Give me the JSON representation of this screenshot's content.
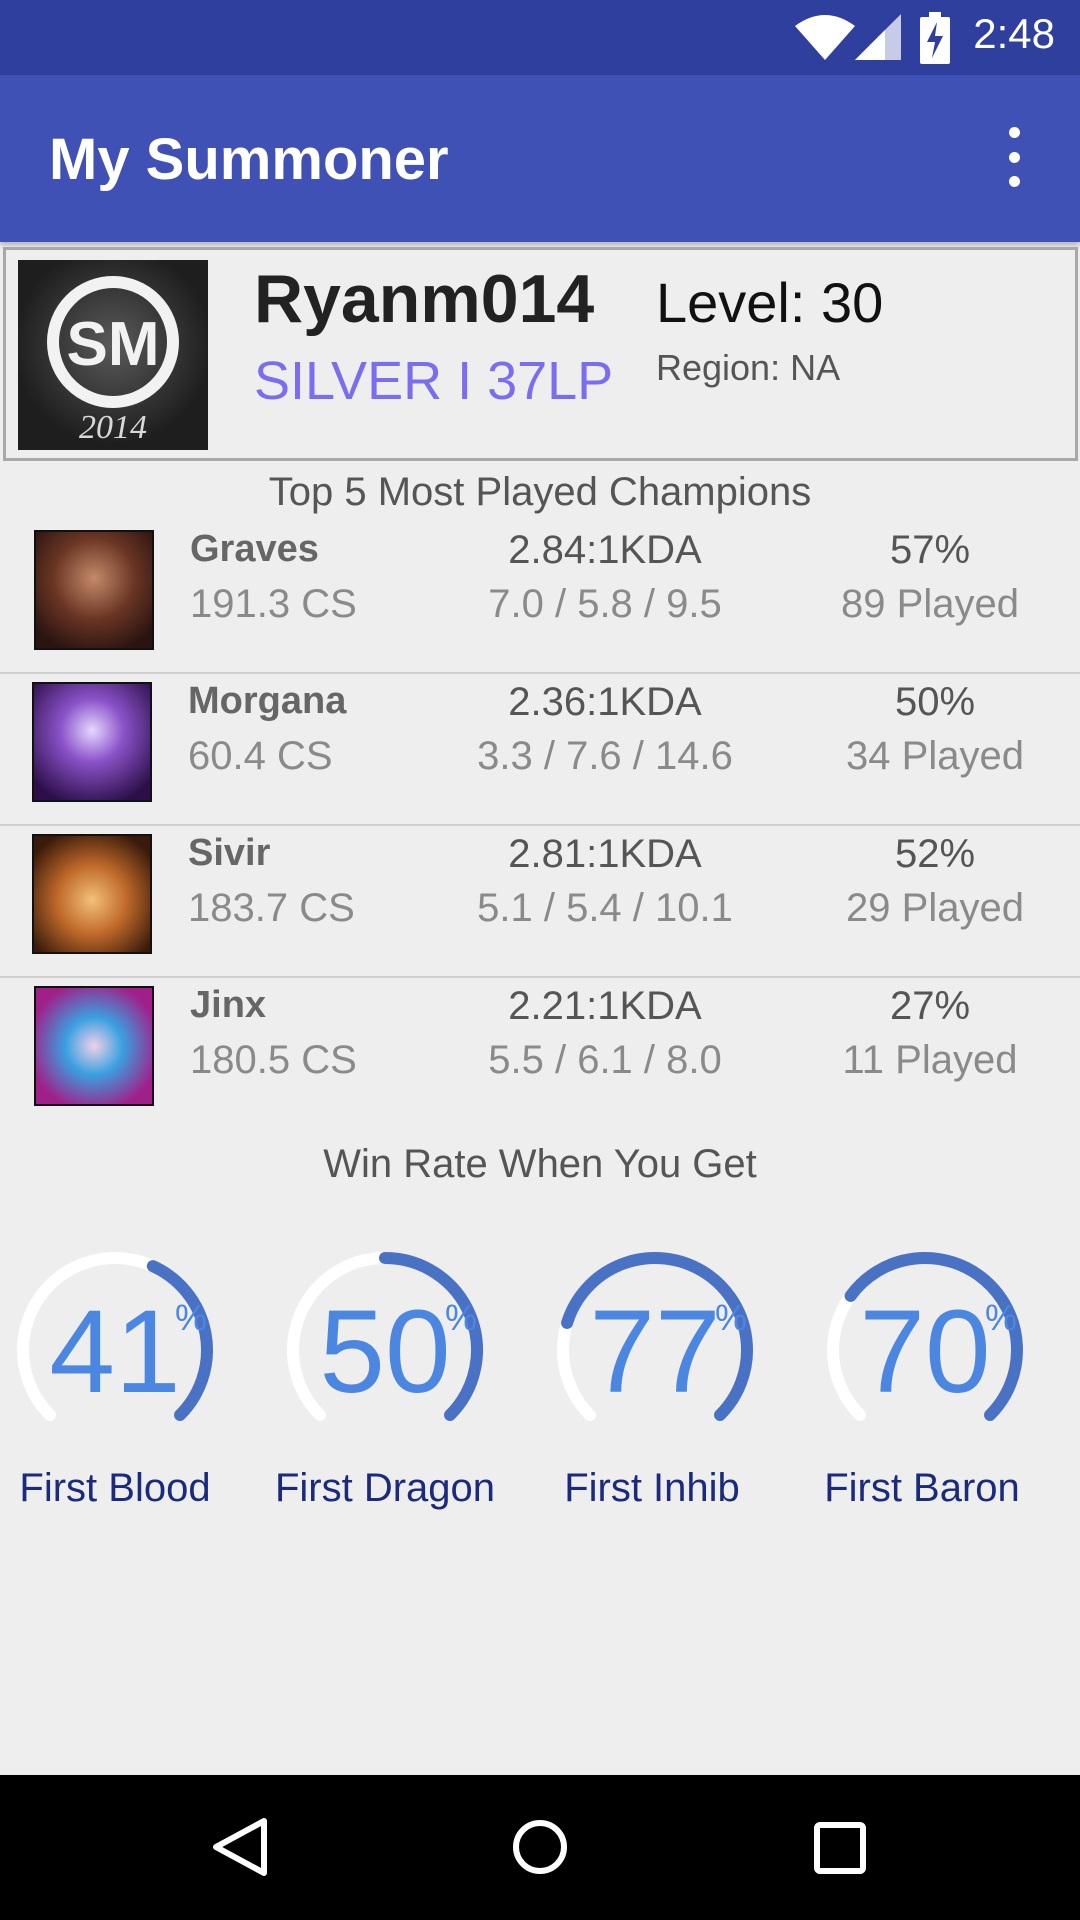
{
  "status_bar": {
    "time": "2:48",
    "icons": [
      "wifi-icon",
      "signal-icon",
      "battery-charging-icon"
    ]
  },
  "app_bar": {
    "title": "My Summoner",
    "overflow_icon": "more-vert-icon"
  },
  "summoner": {
    "icon_text": "2014",
    "icon_logo": "SM",
    "name": "Ryanm014",
    "rank": "SILVER I 37LP",
    "level": "Level: 30",
    "region": "Region: NA"
  },
  "champions_section": {
    "title": "Top 5 Most Played Champions",
    "rows": [
      {
        "name": "Graves",
        "cs": "191.3 CS",
        "kda": "2.84:1KDA",
        "kda_detail": "7.0 / 5.8 / 9.5",
        "winrate": "57%",
        "played": "89 Played"
      },
      {
        "name": "Morgana",
        "cs": "60.4 CS",
        "kda": "2.36:1KDA",
        "kda_detail": "3.3 / 7.6 / 14.6",
        "winrate": "50%",
        "played": "34 Played"
      },
      {
        "name": "Sivir",
        "cs": "183.7 CS",
        "kda": "2.81:1KDA",
        "kda_detail": "5.1 / 5.4 / 10.1",
        "winrate": "52%",
        "played": "29 Played"
      },
      {
        "name": "Jinx",
        "cs": "180.5 CS",
        "kda": "2.21:1KDA",
        "kda_detail": "5.5 / 6.1 / 8.0",
        "winrate": "27%",
        "played": "11 Played"
      }
    ]
  },
  "winrate_section": {
    "title": "Win Rate When You Get",
    "pct_symbol": "%",
    "gauges": [
      {
        "value": "41",
        "label": "First Blood",
        "fraction": 0.41
      },
      {
        "value": "50",
        "label": "First Dragon",
        "fraction": 0.5
      },
      {
        "value": "77",
        "label": "First Inhib",
        "fraction": 0.77
      },
      {
        "value": "70",
        "label": "First Baron",
        "fraction": 0.7
      }
    ]
  },
  "colors": {
    "status_bar": "#2f3f9e",
    "app_bar": "#3f51b5",
    "rank": "#7a6df0",
    "gauge_fill": "#4a72c4",
    "gauge_text": "#4b86e0",
    "gauge_label": "#1a2a7c"
  },
  "nav_bar": {
    "icons": [
      "back-icon",
      "home-icon",
      "recents-icon"
    ]
  }
}
